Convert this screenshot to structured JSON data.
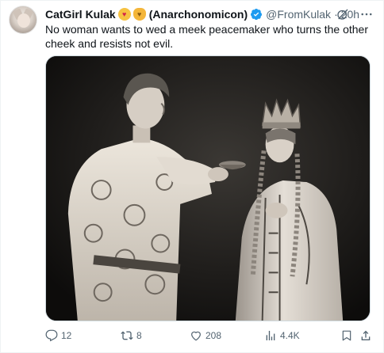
{
  "author": {
    "name": "CatGirl Kulak",
    "emojis": [
      "heart-eyes-emoji",
      "cat-heart-eyes-emoji"
    ],
    "name_suffix": "(Anarchonomicon)",
    "handle": "@FromKulak",
    "separator": "·",
    "time": "20h"
  },
  "tweet": {
    "text": "No woman wants to wed a meek peacemaker who turns the other cheek and resists not evil."
  },
  "media": {
    "kind": "black-and-white film still",
    "icon": "photo"
  },
  "actions": {
    "reply_count": "12",
    "retweet_count": "8",
    "like_count": "208",
    "views_count": "4.4K"
  },
  "icons": {
    "verified": "verified-badge-icon",
    "grok": "grok-icon",
    "more": "more-icon",
    "reply": "reply-icon",
    "retweet": "retweet-icon",
    "like": "heart-icon",
    "views": "views-icon",
    "bookmark": "bookmark-icon",
    "share": "share-icon"
  },
  "colors": {
    "text_primary": "#0f1419",
    "text_secondary": "#536471",
    "verified_blue": "#1d9bf0",
    "border": "#cfd9de"
  }
}
